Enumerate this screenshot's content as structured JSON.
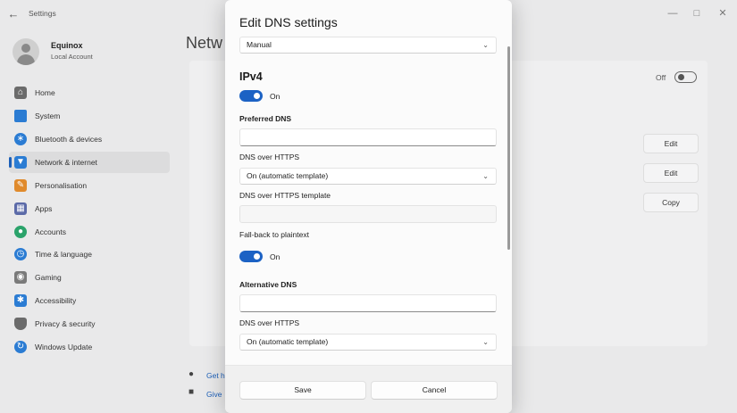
{
  "window": {
    "app_title": "Settings",
    "back_icon": "arrow-left-icon",
    "controls": [
      "minimize-icon",
      "maximize-icon",
      "close-icon"
    ]
  },
  "user": {
    "name": "Equinox",
    "subtitle": "Local Account"
  },
  "sidebar": {
    "items": [
      {
        "label": "Home",
        "icon": "home-icon",
        "color": "#6b6b6b"
      },
      {
        "label": "System",
        "icon": "monitor-icon",
        "color": "#2b7cd3"
      },
      {
        "label": "Bluetooth & devices",
        "icon": "bluetooth-icon",
        "color": "#2b7cd3"
      },
      {
        "label": "Network & internet",
        "icon": "wifi-icon",
        "color": "#2b7cd3",
        "active": true
      },
      {
        "label": "Personalisation",
        "icon": "brush-icon",
        "color": "#e08a2c"
      },
      {
        "label": "Apps",
        "icon": "apps-icon",
        "color": "#5b6aa8"
      },
      {
        "label": "Accounts",
        "icon": "person-icon",
        "color": "#2ba36b"
      },
      {
        "label": "Time & language",
        "icon": "globe-clock-icon",
        "color": "#2b7cd3"
      },
      {
        "label": "Gaming",
        "icon": "gamepad-icon",
        "color": "#7a7a7a"
      },
      {
        "label": "Accessibility",
        "icon": "accessibility-icon",
        "color": "#2b7cd3"
      },
      {
        "label": "Privacy & security",
        "icon": "shield-icon",
        "color": "#6b6b6b"
      },
      {
        "label": "Windows Update",
        "icon": "update-icon",
        "color": "#2b7cd3"
      }
    ]
  },
  "background": {
    "heading": "Netw",
    "toggle_state": "Off",
    "buttons": [
      "Edit",
      "Edit",
      "Copy"
    ],
    "links": [
      "Get h",
      "Give"
    ]
  },
  "dialog": {
    "title": "Edit DNS settings",
    "mode_select": "Manual",
    "section": "IPv4",
    "ipv4_toggle": "On",
    "preferred_dns_label": "Preferred DNS",
    "preferred_dns_value": "",
    "doh_label_1": "DNS over HTTPS",
    "doh_value_1": "On (automatic template)",
    "doh_template_label": "DNS over HTTPS template",
    "fallback_label": "Fall-back to plaintext",
    "fallback_toggle": "On",
    "alternative_dns_label": "Alternative DNS",
    "alternative_dns_value": "",
    "doh_label_2": "DNS over HTTPS",
    "doh_value_2": "On (automatic template)",
    "save_label": "Save",
    "cancel_label": "Cancel",
    "accent": "#1c62c4"
  }
}
